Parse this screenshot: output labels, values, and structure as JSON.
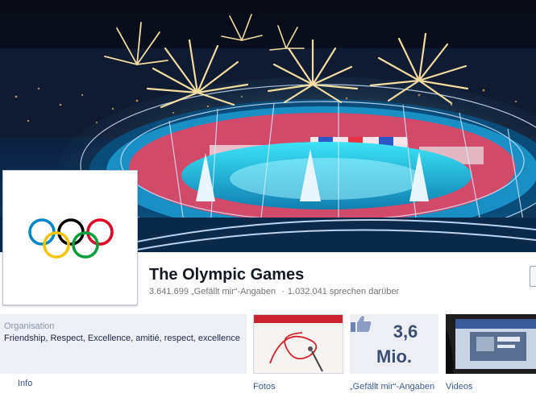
{
  "page": {
    "name": "The Olympic Games",
    "likes_count": "3.641.699",
    "likes_text": "„Gefällt mir“-Angaben",
    "separator": "·",
    "talking_count": "1.032.041",
    "talking_text": "sprechen darüber"
  },
  "cover": {
    "description": "Stadium opening ceremony with fireworks",
    "colors": {
      "sky": "#0c1326",
      "field": "#2bd0e8",
      "firework": "#ffe7a8"
    }
  },
  "profile": {
    "logo": "olympic-rings",
    "ring_colors": [
      "#0085c7",
      "#f4c300",
      "#000000",
      "#009f3d",
      "#df0024"
    ]
  },
  "info": {
    "category": "Organisation",
    "description": "Friendship, Respect, Excellence, amitié, respect, excellence",
    "link_label": "Info"
  },
  "tiles": {
    "photos_label": "Fotos",
    "likes_number": "3,6",
    "likes_unit": "Mio.",
    "likes_label": "„Gefällt mir“-Angaben",
    "videos_label": "Videos"
  }
}
